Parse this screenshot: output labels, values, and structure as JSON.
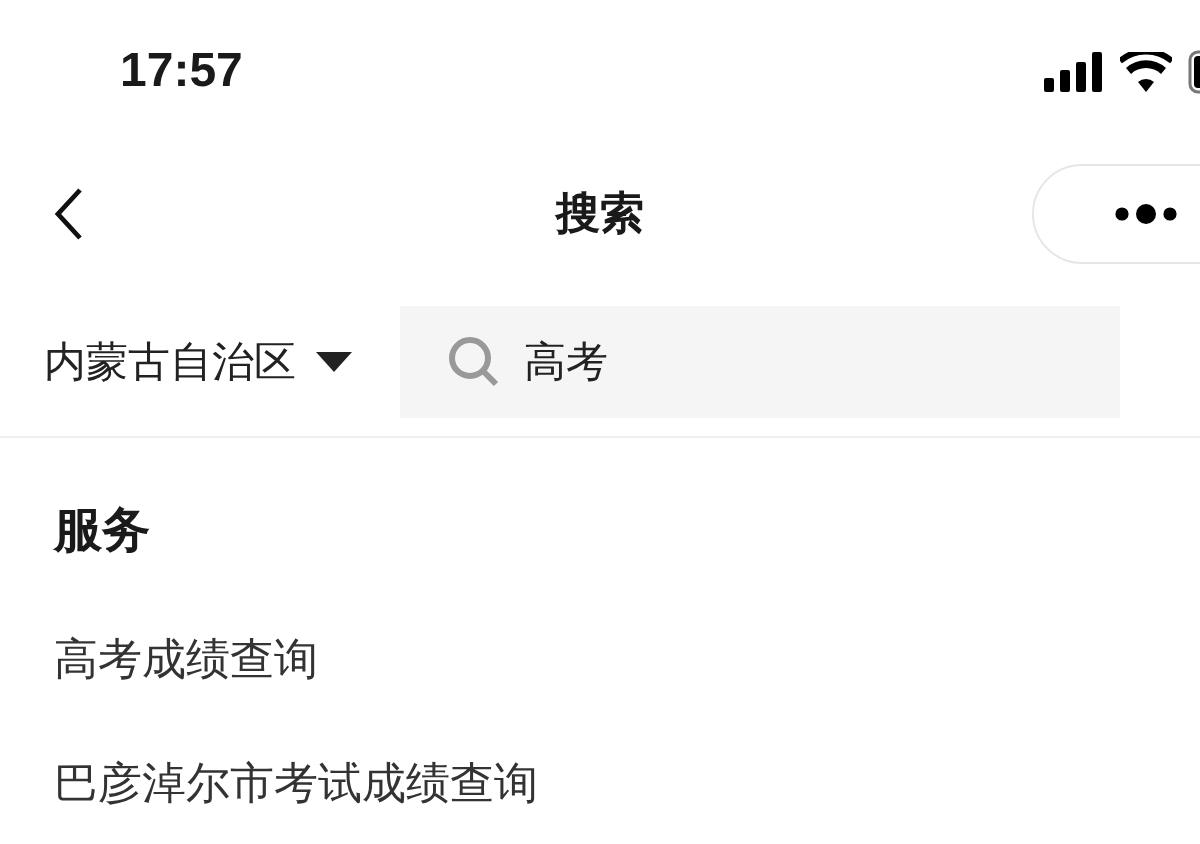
{
  "status_bar": {
    "time": "17:57"
  },
  "nav": {
    "title": "搜索"
  },
  "filter": {
    "region": "内蒙古自治区",
    "search": {
      "value": "高考"
    }
  },
  "section": {
    "title": "服务",
    "items": [
      "高考成绩查询",
      "巴彦淖尔市考试成绩查询"
    ]
  }
}
